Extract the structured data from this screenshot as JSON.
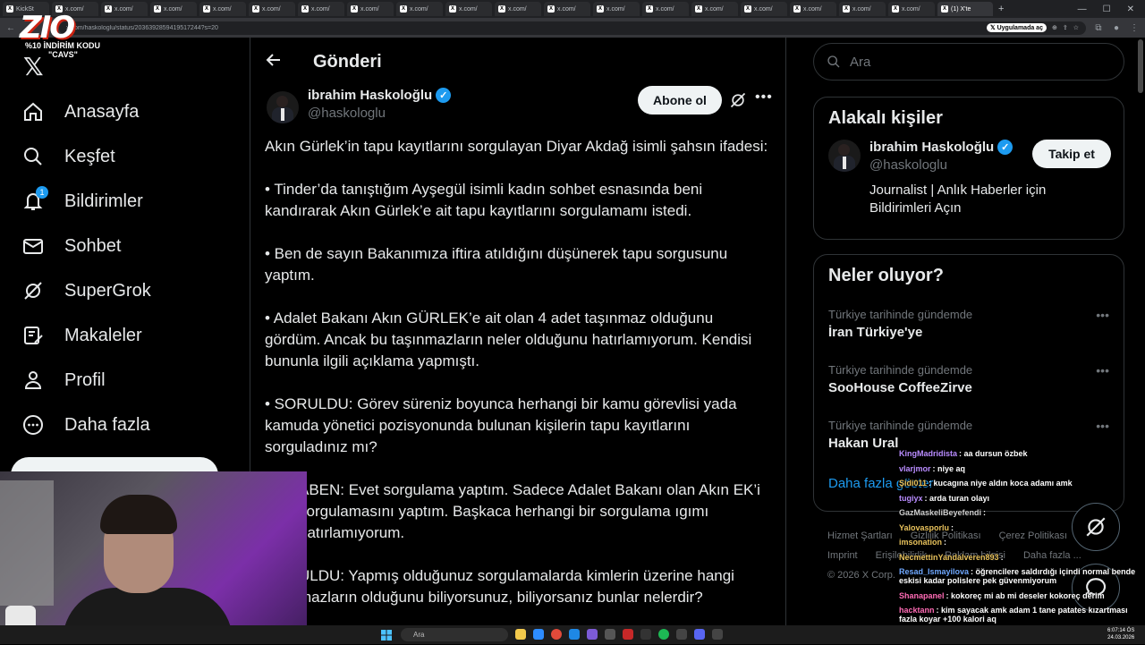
{
  "browser": {
    "tabs": [
      "KickSt",
      "x.com/",
      "x.com/",
      "x.com/",
      "x.com/",
      "x.com/",
      "x.com/",
      "x.com/",
      "x.com/",
      "x.com/",
      "x.com/",
      "x.com/",
      "x.com/",
      "x.com/",
      "x.com/",
      "x.com/",
      "x.com/",
      "x.com/",
      "x.com/"
    ],
    "active_tab": "(1) X'te",
    "url": "x.com/haskologlu/status/2036392859419517244?s=20",
    "app_button": "Uygulamada aç"
  },
  "stream_overlay": {
    "logo": "ZIO",
    "promo_line1": "%10 İNDİRİM KODU",
    "promo_line2": "\"CAVS\""
  },
  "sidebar": {
    "logo": "𝕏",
    "items": [
      {
        "label": "Anasayfa",
        "icon": "home-icon"
      },
      {
        "label": "Keşfet",
        "icon": "search-icon"
      },
      {
        "label": "Bildirimler",
        "icon": "bell-icon",
        "badge": "1"
      },
      {
        "label": "Sohbet",
        "icon": "mail-icon"
      },
      {
        "label": "SuperGrok",
        "icon": "grok-icon"
      },
      {
        "label": "Makaleler",
        "icon": "article-icon"
      },
      {
        "label": "Profil",
        "icon": "profile-icon"
      },
      {
        "label": "Daha fazla",
        "icon": "more-circle-icon"
      }
    ]
  },
  "main": {
    "title": "Gönderi",
    "author": {
      "name": "ibrahim Haskoloğlu",
      "handle": "@haskologlu"
    },
    "subscribe_label": "Abone ol",
    "paragraphs": [
      "Akın Gürlek’in tapu kayıtlarını sorgulayan Diyar Akdağ isimli şahsın ifadesi:",
      "• Tinder’da tanıştığım Ayşegül isimli kadın sohbet esnasında beni kandırarak Akın Gürlek’e ait tapu kayıtlarını sorgulamamı istedi.",
      "• Ben de sayın Bakanımıza iftira atıldığını düşünerek tapu sorgusunu yaptım.",
      "• Adalet Bakanı Akın GÜRLEK’e ait olan 4 adet taşınmaz olduğunu gördüm. Ancak bu taşınmazların neler olduğunu hatırlamıyorum. Kendisi bununla ilgili açıklama yapmıştı.",
      "• SORULDU: Görev süreniz boyunca herhangi bir kamu görevlisi yada kamuda yönetici pozisyonunda bulunan kişilerin tapu kayıtlarını sorguladınız mı?",
      "ABEN: Evet sorgulama yaptım. Sadece Adalet Bakanı olan Akın EK’i sorgulamasını yaptım. Başkaca herhangi bir sorgulama ıgımı hatırlamıyorum.",
      "ULDU: Yapmış olduğunuz sorgulamalarda kimlerin üzerine hangi mazların olduğunu biliyorsunuz, biliyorsanız bunlar nelerdir?"
    ]
  },
  "right": {
    "search_placeholder": "Ara",
    "related_title": "Alakalı kişiler",
    "related_person": {
      "name": "ibrahim Haskoloğlu",
      "handle": "@haskologlu",
      "bio": "Journalist | Anlık Haberler için Bildirimleri Açın",
      "follow_label": "Takip et"
    },
    "trends_title": "Neler oluyor?",
    "trends": [
      {
        "meta": "Türkiye tarihinde gündemde",
        "name": "İran Türkiye'ye"
      },
      {
        "meta": "Türkiye tarihinde gündemde",
        "name": "SooHouse CoffeeZirve"
      },
      {
        "meta": "Türkiye tarihinde gündemde",
        "name": "Hakan Ural"
      }
    ],
    "show_more": "Daha fazla göster",
    "footer_links": [
      "Hizmet Şartları",
      "Gizlilik Politikası",
      "Çerez Politikası",
      "Imprint",
      "Erişilebilirlik",
      "Reklam bilgisi",
      "Daha fazla ...",
      "© 2026 X Corp."
    ]
  },
  "chat": [
    {
      "user": "KingMadridista",
      "color": "#b98cff",
      "msg": ": aa dursun özbek"
    },
    {
      "user": "vlarjmor",
      "color": "#b98cff",
      "msg": ": niye aq"
    },
    {
      "user": "Şidi011",
      "color": "#e8c25c",
      "msg": ": kucagına niye aldın koca adamı amk"
    },
    {
      "user": "tugiyx",
      "color": "#b98cff",
      "msg": ": arda turan olayı"
    },
    {
      "user": "GazMaskeliBeyefendi",
      "color": "#d0d0d0",
      "msg": ":"
    },
    {
      "user": "Yalovasporlu",
      "color": "#e8c25c",
      "msg": ":"
    },
    {
      "user": "imsonation",
      "color": "#e8c25c",
      "msg": ":"
    },
    {
      "user": "NecmettinYandalveren893",
      "color": "#e8c25c",
      "msg": ":"
    },
    {
      "user": "Resad_Ismayilova",
      "color": "#6fa8ff",
      "msg": ": öğrencilere saldırdığı içindi normal bende eskisi kadar polislere pek güvenmiyorum"
    },
    {
      "user": "Shanapanel",
      "color": "#ff6bb5",
      "msg": ": kokoreç mi ab mi deseler kokoreç derim"
    },
    {
      "user": "hacktann",
      "color": "#ff6bb5",
      "msg": ": kim sayacak amk adam 1 tane patates kızartması fazla koyar +100 kalori aq"
    }
  ],
  "taskbar": {
    "search_placeholder": "Ara",
    "time": "6:07:14 ÖS",
    "date": "24.03.2026"
  },
  "colors": {
    "accent": "#1d9bf0",
    "background": "#000000",
    "text": "#e7e9ea",
    "muted": "#71767b",
    "border": "#2f3336"
  }
}
